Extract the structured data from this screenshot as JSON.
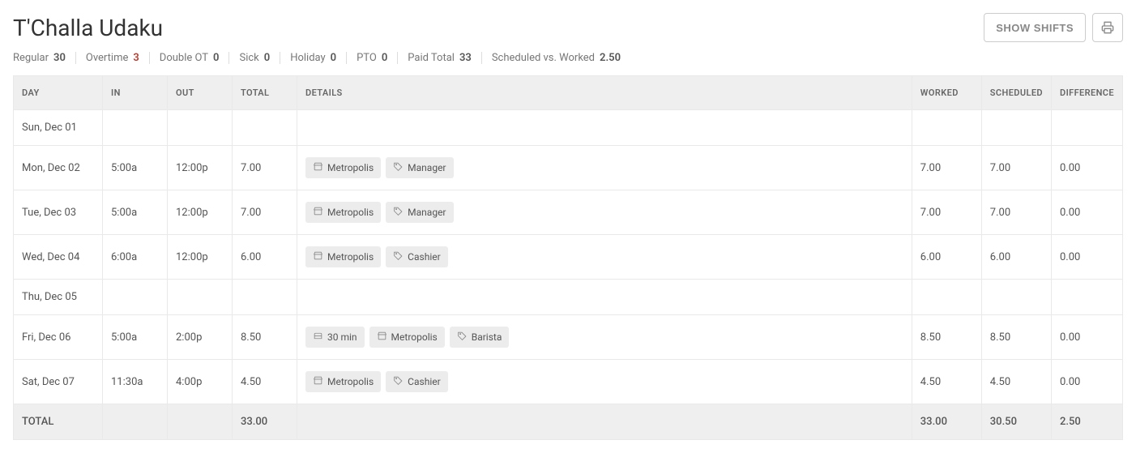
{
  "header": {
    "title": "T'Challa Udaku",
    "show_shifts_label": "SHOW SHIFTS"
  },
  "summary": [
    {
      "label": "Regular",
      "value": "30"
    },
    {
      "label": "Overtime",
      "value": "3",
      "red": true
    },
    {
      "label": "Double OT",
      "value": "0"
    },
    {
      "label": "Sick",
      "value": "0"
    },
    {
      "label": "Holiday",
      "value": "0"
    },
    {
      "label": "PTO",
      "value": "0"
    },
    {
      "label": "Paid Total",
      "value": "33"
    },
    {
      "label": "Scheduled vs. Worked",
      "value": "2.50"
    }
  ],
  "columns": {
    "day": "DAY",
    "in": "IN",
    "out": "OUT",
    "total": "TOTAL",
    "details": "DETAILS",
    "worked": "WORKED",
    "scheduled": "SCHEDULED",
    "difference": "DIFFERENCE"
  },
  "rows": [
    {
      "day": "Sun, Dec 01",
      "in": "",
      "out": "",
      "total": "",
      "details": [],
      "worked": "",
      "scheduled": "",
      "difference": ""
    },
    {
      "day": "Mon, Dec 02",
      "in": "5:00a",
      "out": "12:00p",
      "total": "7.00",
      "details": [
        {
          "icon": "store",
          "text": "Metropolis"
        },
        {
          "icon": "tag",
          "text": "Manager"
        }
      ],
      "worked": "7.00",
      "scheduled": "7.00",
      "difference": "0.00"
    },
    {
      "day": "Tue, Dec 03",
      "in": "5:00a",
      "out": "12:00p",
      "total": "7.00",
      "details": [
        {
          "icon": "store",
          "text": "Metropolis"
        },
        {
          "icon": "tag",
          "text": "Manager"
        }
      ],
      "worked": "7.00",
      "scheduled": "7.00",
      "difference": "0.00"
    },
    {
      "day": "Wed, Dec 04",
      "in": "6:00a",
      "out": "12:00p",
      "total": "6.00",
      "details": [
        {
          "icon": "store",
          "text": "Metropolis"
        },
        {
          "icon": "tag",
          "text": "Cashier"
        }
      ],
      "worked": "6.00",
      "scheduled": "6.00",
      "difference": "0.00"
    },
    {
      "day": "Thu, Dec 05",
      "in": "",
      "out": "",
      "total": "",
      "details": [],
      "worked": "",
      "scheduled": "",
      "difference": ""
    },
    {
      "day": "Fri, Dec 06",
      "in": "5:00a",
      "out": "2:00p",
      "total": "8.50",
      "details": [
        {
          "icon": "break",
          "text": "30 min"
        },
        {
          "icon": "store",
          "text": "Metropolis"
        },
        {
          "icon": "tag",
          "text": "Barista"
        }
      ],
      "worked": "8.50",
      "scheduled": "8.50",
      "difference": "0.00"
    },
    {
      "day": "Sat, Dec 07",
      "in": "11:30a",
      "out": "4:00p",
      "total": "4.50",
      "details": [
        {
          "icon": "store",
          "text": "Metropolis"
        },
        {
          "icon": "tag",
          "text": "Cashier"
        }
      ],
      "worked": "4.50",
      "scheduled": "4.50",
      "difference": "0.00"
    }
  ],
  "total_row": {
    "label": "TOTAL",
    "total": "33.00",
    "worked": "33.00",
    "scheduled": "30.50",
    "difference": "2.50"
  }
}
